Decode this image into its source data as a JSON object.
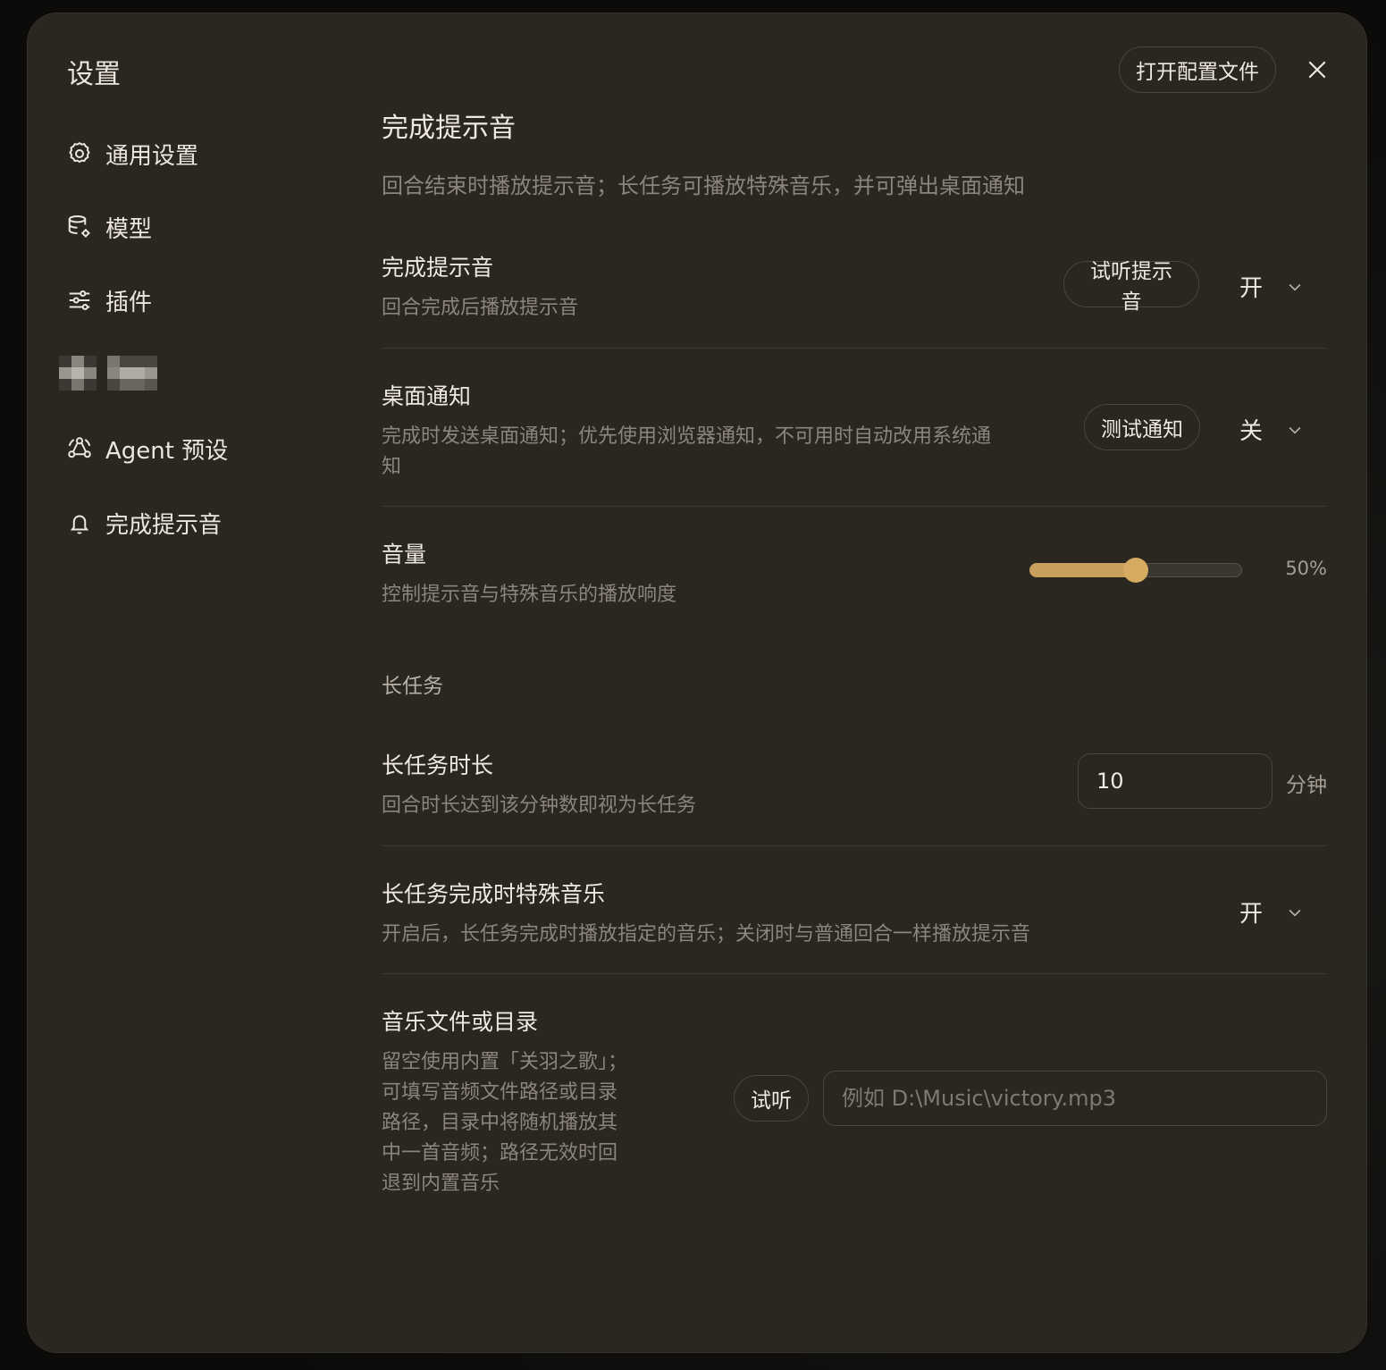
{
  "dialog": {
    "title": "设置",
    "open_config_label": "打开配置文件"
  },
  "sidebar": {
    "items": [
      {
        "label": "通用设置",
        "icon": "gear-icon"
      },
      {
        "label": "模型",
        "icon": "database-gear-icon"
      },
      {
        "label": "插件",
        "icon": "sliders-icon"
      },
      {
        "label": "Agent 预设",
        "icon": "agent-nodes-icon"
      },
      {
        "label": "完成提示音",
        "icon": "bell-icon"
      }
    ]
  },
  "section": {
    "title": "完成提示音",
    "description": "回合结束时播放提示音；长任务可播放特殊音乐，并可弹出桌面通知"
  },
  "rows": {
    "sound": {
      "title": "完成提示音",
      "description": "回合完成后播放提示音",
      "button_label": "试听提示音",
      "value": "开"
    },
    "notify": {
      "title": "桌面通知",
      "description": "完成时发送桌面通知；优先使用浏览器通知，不可用时自动改用系统通知",
      "button_label": "测试通知",
      "value": "关"
    },
    "volume": {
      "title": "音量",
      "description": "控制提示音与特殊音乐的播放响度",
      "percent": 50,
      "value_label": "50%"
    },
    "long_task_header": "长任务",
    "duration": {
      "title": "长任务时长",
      "description": "回合时长达到该分钟数即视为长任务",
      "value": "10",
      "unit": "分钟"
    },
    "special_music": {
      "title": "长任务完成时特殊音乐",
      "description": "开启后，长任务完成时播放指定的音乐；关闭时与普通回合一样播放提示音",
      "value": "开"
    },
    "music_path": {
      "title": "音乐文件或目录",
      "description": "留空使用内置「关羽之歌」；可填写音频文件路径或目录路径，目录中将随机播放其中一首音频；路径无效时回退到内置音乐",
      "button_label": "试听",
      "placeholder": "例如 D:\\Music\\victory.mp3"
    }
  },
  "colors": {
    "accent": "#c6a05c",
    "background": "#2a2620",
    "text_primary": "#efe9df",
    "text_secondary": "#8b857b"
  }
}
